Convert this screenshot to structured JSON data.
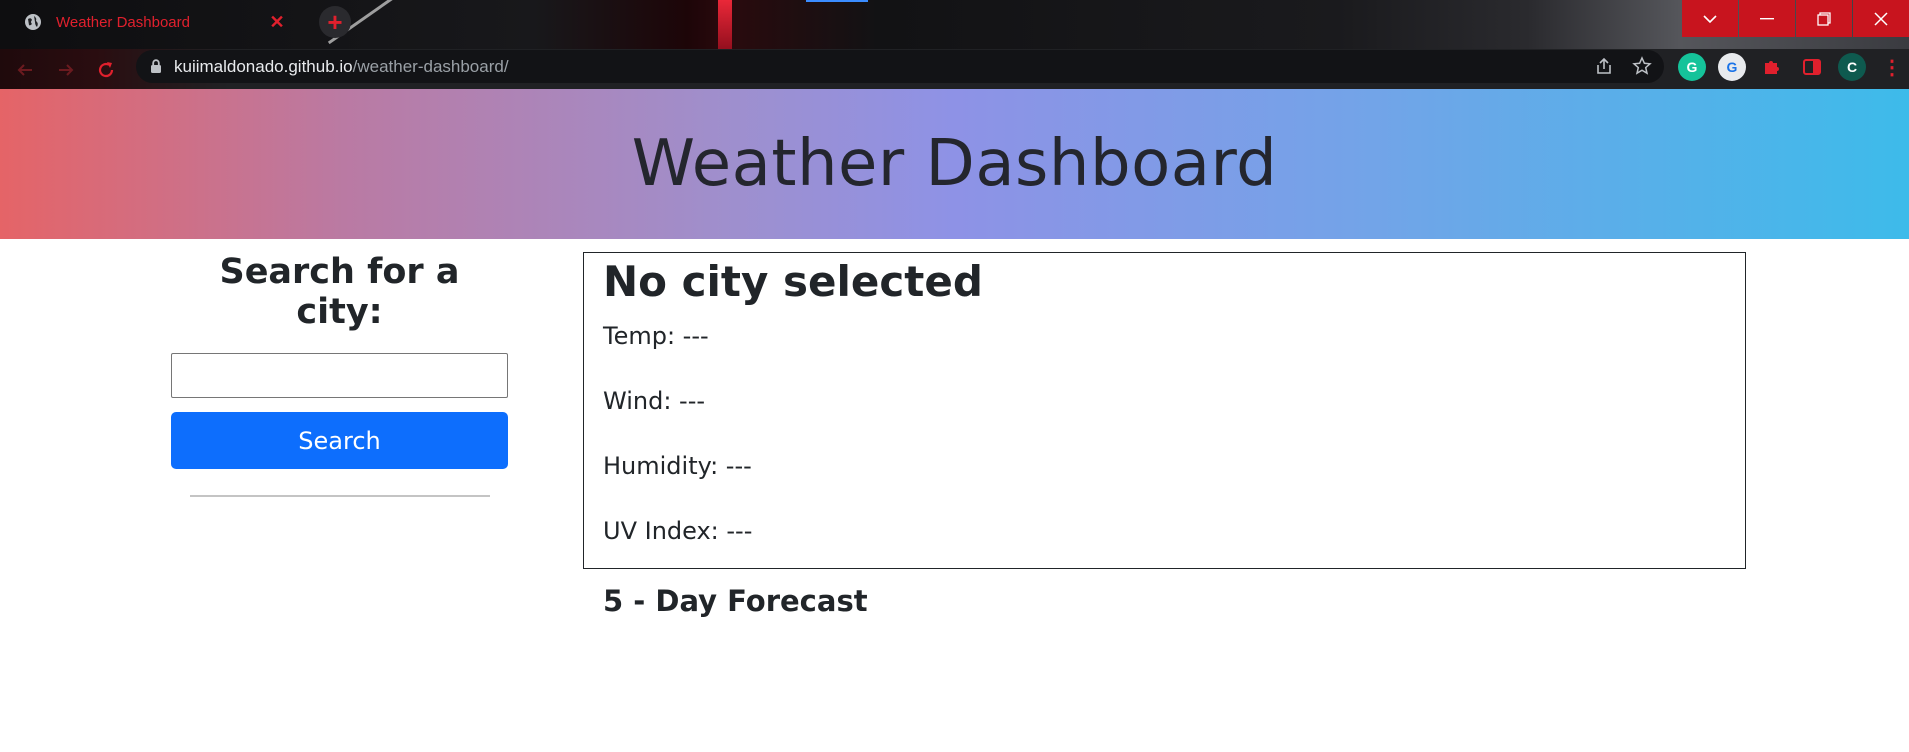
{
  "browser": {
    "tab_title": "Weather Dashboard",
    "url_host": "kuiimaldonado.github.io",
    "url_path": "/weather-dashboard/",
    "profile_initial": "C"
  },
  "header": {
    "title": "Weather Dashboard"
  },
  "sidebar": {
    "heading": "Search for a city:",
    "search_value": "",
    "search_button": "Search"
  },
  "current": {
    "city": "No city selected",
    "temp": "Temp: ---",
    "wind": "Wind: ---",
    "humidity": "Humidity: ---",
    "uv_index": "UV Index: ---"
  },
  "forecast": {
    "title": "5 - Day Forecast"
  },
  "colors": {
    "search_button": "#0d6efd",
    "tab_accent": "#e0202d",
    "window_controls": "#c8141e"
  }
}
